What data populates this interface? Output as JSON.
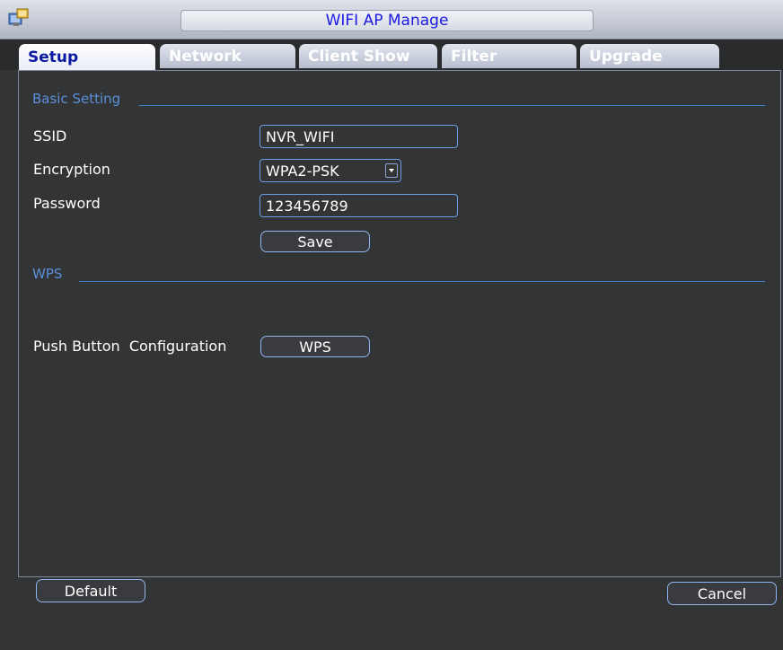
{
  "window": {
    "title": "WIFI AP Manage"
  },
  "tabs": [
    {
      "label": "Setup"
    },
    {
      "label": "Network"
    },
    {
      "label": "Client Show"
    },
    {
      "label": "Filter"
    },
    {
      "label": "Upgrade"
    }
  ],
  "basic": {
    "section_label": "Basic Setting",
    "ssid_label": "SSID",
    "ssid_value": "NVR_WIFI",
    "encryption_label": "Encryption",
    "encryption_value": "WPA2-PSK",
    "password_label": "Password",
    "password_value": "123456789",
    "save_label": "Save"
  },
  "wps": {
    "section_label": "WPS",
    "push_label": "Push Button  Configuration",
    "wps_button_label": "WPS"
  },
  "footer": {
    "default_label": "Default",
    "cancel_label": "Cancel"
  },
  "colors": {
    "title_text": "#1a1ae0",
    "active_tab_text": "#0a1aa0",
    "section_label": "#5b8fd8",
    "field_border": "#6c9ee8",
    "background": "#333436"
  },
  "icons": {
    "app_icon": "app-window-icon",
    "dropdown": "chevron-down-icon"
  }
}
